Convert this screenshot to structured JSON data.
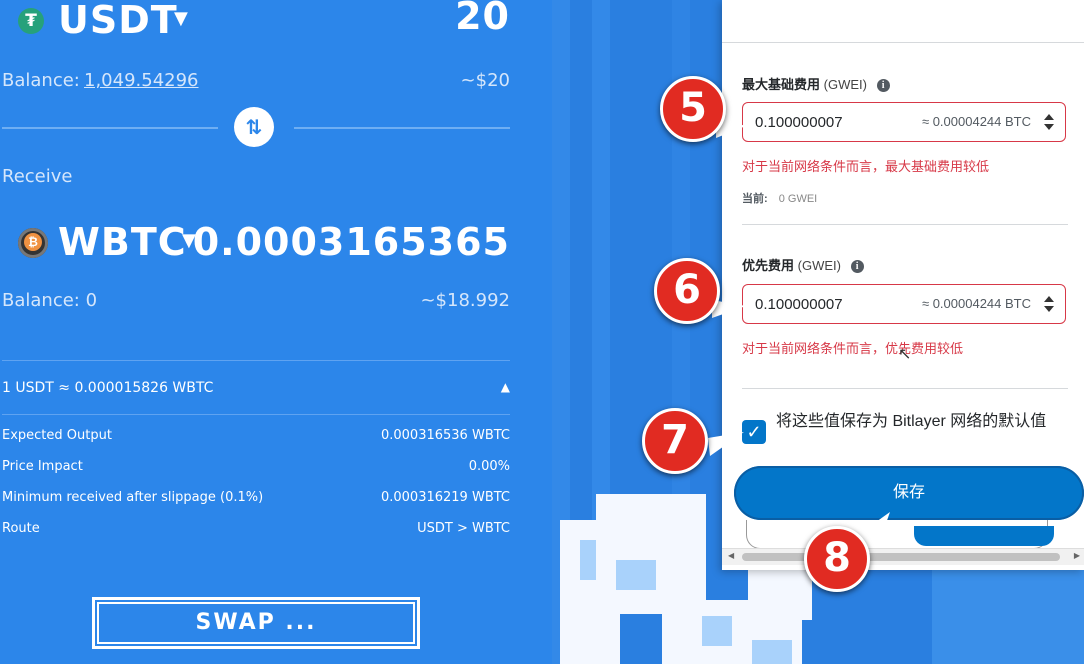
{
  "swap": {
    "from_token": "USDT",
    "from_amount": "20",
    "from_balance_label": "Balance:",
    "from_balance_value": "1,049.54296",
    "from_usd": "~$20",
    "receive_label": "Receive",
    "to_token": "WBTC",
    "to_amount": "0.0003165365",
    "to_balance": "Balance: 0",
    "to_usd": "~$18.992",
    "rate": "1 USDT ≈ 0.000015826 WBTC",
    "details": [
      {
        "label": "Expected Output",
        "value": "0.000316536 WBTC"
      },
      {
        "label": "Price Impact",
        "value": "0.00%"
      },
      {
        "label": "Minimum received after slippage (0.1%)",
        "value": "0.000316219 WBTC"
      },
      {
        "label": "Route",
        "value": "USDT > WBTC"
      }
    ],
    "swap_button": "SWAP ..."
  },
  "modal": {
    "max_base_fee_label": "最大基础费用",
    "max_base_fee_unit": "(GWEI)",
    "max_base_fee_value": "0.100000007",
    "max_base_fee_conv": "≈ 0.00004244 BTC",
    "max_base_fee_error": "对于当前网络条件而言，最大基础费用较低",
    "current_label": "当前:",
    "current_value": "0 GWEI",
    "priority_fee_label": "优先费用",
    "priority_fee_unit": "(GWEI)",
    "priority_fee_value": "0.100000007",
    "priority_fee_conv": "≈ 0.00004244 BTC",
    "priority_fee_error": "对于当前网络条件而言，优先费用较低",
    "save_default_label": "将这些值保存为 Bitlayer 网络的默认值",
    "save_button": "保存"
  },
  "callouts": [
    "5",
    "6",
    "7",
    "8"
  ],
  "colors": {
    "accent": "#0376c9",
    "error": "#d73847",
    "panel": "#2c86ea",
    "callout": "#e12b22"
  }
}
